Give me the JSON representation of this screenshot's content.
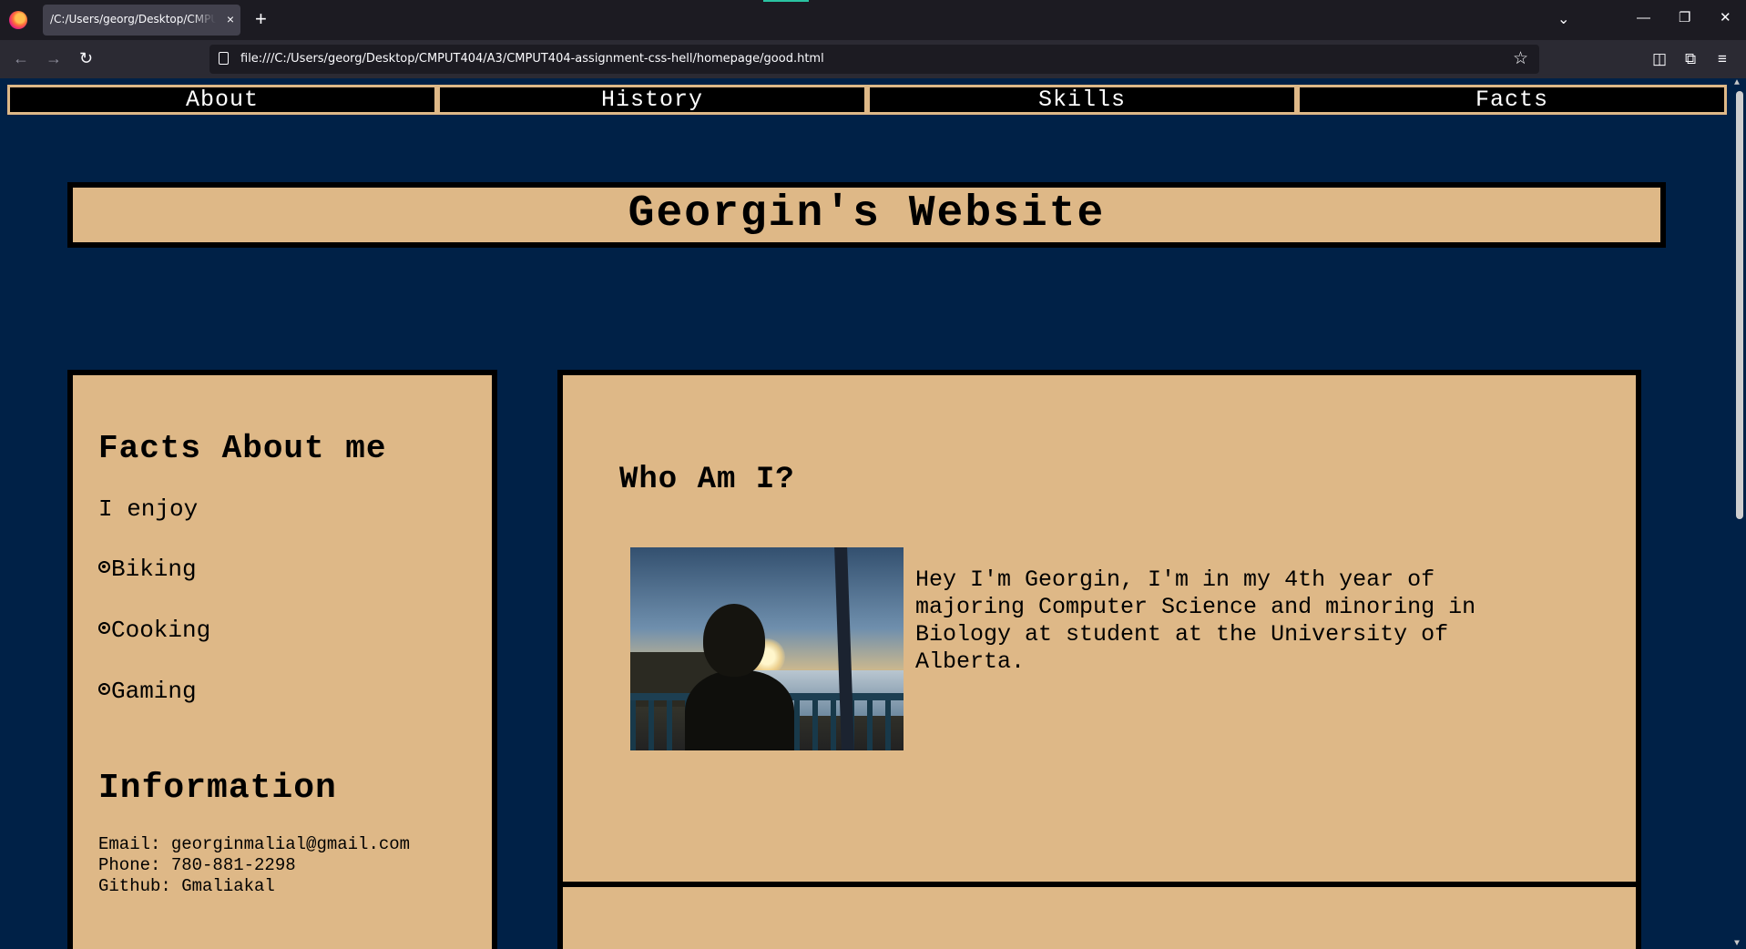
{
  "browser": {
    "tab_title": "/C:/Users/georg/Desktop/CMPUT404/A3/CMPUT404-assignment-css-hell/homepage/good.html",
    "tab_close": "×",
    "new_tab": "+",
    "url": "file:///C:/Users/georg/Desktop/CMPUT404/A3/CMPUT404-assignment-css-hell/homepage/good.html",
    "icons": {
      "back": "←",
      "forward": "→",
      "reload": "↻",
      "bookmark": "☆",
      "pocket": "◫",
      "extensions": "⧉",
      "menu": "≡",
      "list_tabs": "⌄",
      "minimize": "—",
      "restore": "❐",
      "close": "✕"
    }
  },
  "site_nav": {
    "items": [
      "About",
      "History",
      "Skills",
      "Facts"
    ]
  },
  "header": {
    "title": "Georgin's Website"
  },
  "facts_panel": {
    "title": "Facts About me",
    "intro": "I enjoy",
    "items": [
      "Biking",
      "Cooking",
      "Gaming"
    ],
    "info_title": "Information",
    "email": "Email: georginmalial@gmail.com",
    "phone": "Phone: 780-881-2298",
    "github": "Github: Gmaliakal"
  },
  "about_panel": {
    "title": "Who Am I?",
    "text": "Hey I'm Georgin, I'm in my 4th year of majoring Computer Science and minoring in Biology at student at the University of Alberta."
  },
  "colors": {
    "page_background": "#002147",
    "panel": "#deb887",
    "border": "#000000"
  }
}
